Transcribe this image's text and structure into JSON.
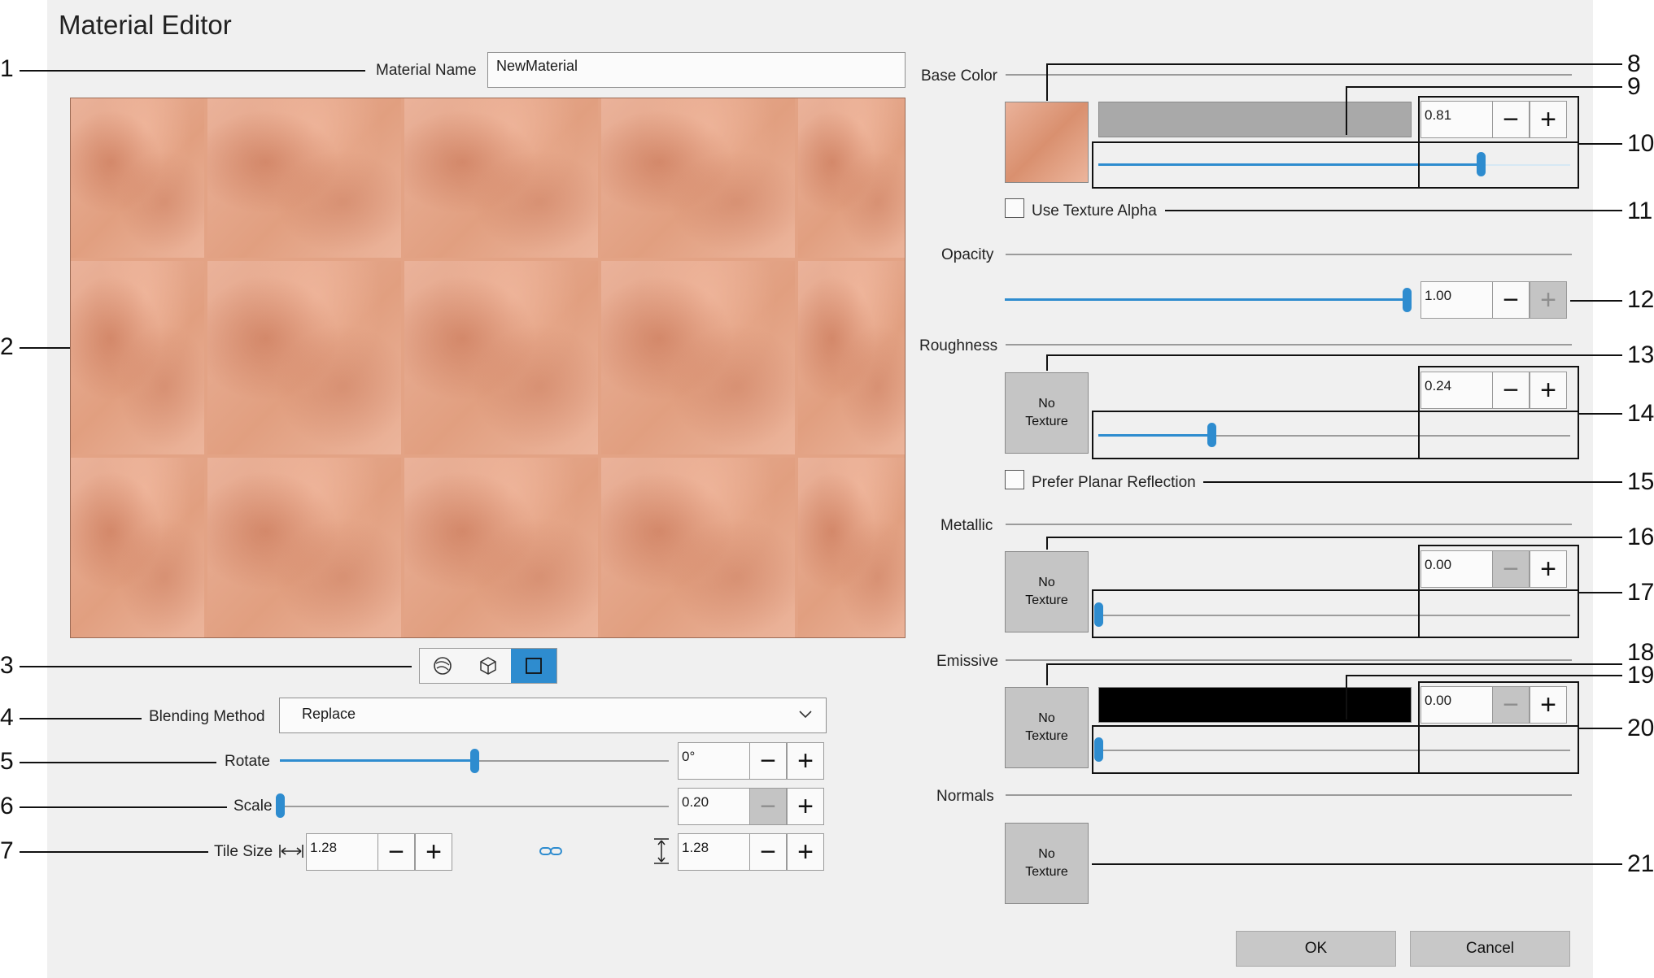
{
  "window": {
    "title": "Material Editor"
  },
  "material_name": {
    "label": "Material Name",
    "value": "NewMaterial"
  },
  "preview_modes": [
    "sphere-icon",
    "cube-icon",
    "plane-icon"
  ],
  "blending": {
    "label": "Blending Method",
    "value": "Replace"
  },
  "rotate": {
    "label": "Rotate",
    "value": "0°",
    "slider_fraction": 0.5
  },
  "scale": {
    "label": "Scale",
    "value": "0.20",
    "slider_fraction": 0.0
  },
  "tile_size": {
    "label": "Tile Size",
    "width": "1.28",
    "height": "1.28"
  },
  "base_color": {
    "label": "Base Color",
    "value": "0.81",
    "slider_fraction": 0.81,
    "swatch_color": "#a9a9a9"
  },
  "use_texture_alpha": {
    "label": "Use Texture Alpha",
    "checked": false
  },
  "opacity": {
    "label": "Opacity",
    "value": "1.00",
    "slider_fraction": 1.0
  },
  "roughness": {
    "label": "Roughness",
    "texture": "No Texture",
    "value": "0.24",
    "slider_fraction": 0.24
  },
  "prefer_planar_reflection": {
    "label": "Prefer Planar Reflection",
    "checked": false
  },
  "metallic": {
    "label": "Metallic",
    "texture": "No Texture",
    "value": "0.00",
    "slider_fraction": 0.0
  },
  "emissive": {
    "label": "Emissive",
    "texture": "No Texture",
    "value": "0.00",
    "slider_fraction": 0.0,
    "swatch_color": "#000000"
  },
  "normals": {
    "label": "Normals",
    "texture": "No Texture"
  },
  "footer": {
    "ok": "OK",
    "cancel": "Cancel"
  },
  "colors": {
    "accent": "#2e8ccf",
    "panel": "#f0f0f0",
    "button": "#c8c8c8"
  },
  "callouts": [
    "1",
    "2",
    "3",
    "4",
    "5",
    "6",
    "7",
    "8",
    "9",
    "10",
    "11",
    "12",
    "13",
    "14",
    "15",
    "16",
    "17",
    "18",
    "19",
    "20",
    "21"
  ]
}
